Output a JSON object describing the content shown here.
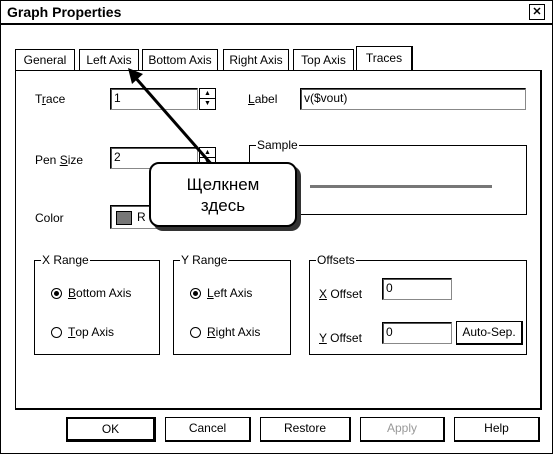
{
  "window": {
    "title": "Graph Properties",
    "close_glyph": "✕"
  },
  "tabs": [
    {
      "label": "General"
    },
    {
      "label": "Left Axis"
    },
    {
      "label": "Bottom Axis"
    },
    {
      "label": "Right Axis"
    },
    {
      "label": "Top Axis"
    },
    {
      "label": "Traces",
      "active": true
    }
  ],
  "trace": {
    "label_pre": "T",
    "label_u": "r",
    "label_post": "ace",
    "value": "1"
  },
  "label_field": {
    "label_pre": "",
    "label_u": "L",
    "label_post": "abel",
    "value": "v($vout)"
  },
  "pen_size": {
    "label_pre": "Pen ",
    "label_u": "S",
    "label_post": "ize",
    "value": "2"
  },
  "color": {
    "label": "Color",
    "value": "R",
    "swatch": "#777777"
  },
  "sample": {
    "legend": "Sample",
    "line_color": "#777777"
  },
  "x_range": {
    "legend": "X Range",
    "options": [
      {
        "pre": "",
        "u": "B",
        "post": "ottom Axis",
        "checked": true
      },
      {
        "pre": "",
        "u": "T",
        "post": "op Axis",
        "checked": false
      }
    ]
  },
  "y_range": {
    "legend": "Y Range",
    "options": [
      {
        "pre": "",
        "u": "L",
        "post": "eft Axis",
        "checked": true
      },
      {
        "pre": "",
        "u": "R",
        "post": "ight Axis",
        "checked": false
      }
    ]
  },
  "offsets": {
    "legend": "Offsets",
    "x_label_u": "X",
    "x_label_post": " Offset",
    "x_value": "0",
    "y_label_u": "Y",
    "y_label_post": " Offset",
    "y_value": "0",
    "auto_sep": "Auto-Sep."
  },
  "buttons": {
    "ok": "OK",
    "cancel": "Cancel",
    "restore": "Restore",
    "apply": "Apply",
    "help": "Help"
  },
  "callout": {
    "line1": "Щелкнем",
    "line2": "здесь"
  }
}
